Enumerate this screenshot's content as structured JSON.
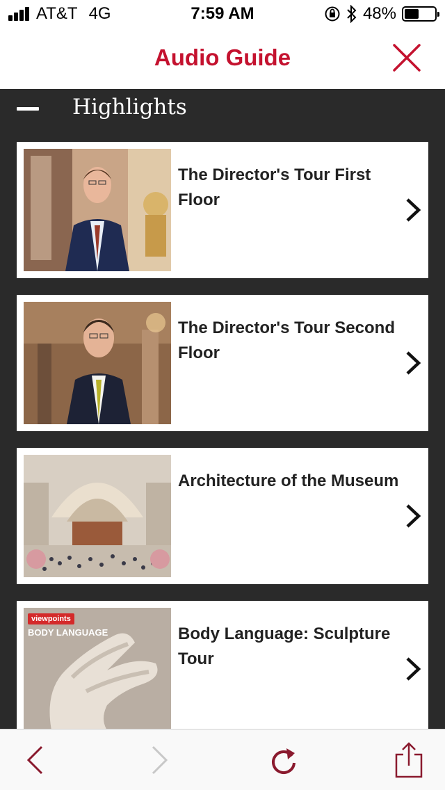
{
  "status_bar": {
    "carrier": "AT&T",
    "network": "4G",
    "time": "7:59 AM",
    "battery": "48%",
    "battery_level": 0.48
  },
  "header": {
    "title": "Audio Guide",
    "close_icon": "close-x-icon"
  },
  "section": {
    "title": "Highlights",
    "toggle_icon": "minus-icon"
  },
  "cards": [
    {
      "title": "The Director's Tour First Floor",
      "image": "director-portrait-first-floor"
    },
    {
      "title": "The Director's Tour Second Floor",
      "image": "director-portrait-second-floor"
    },
    {
      "title": "Architecture of the Museum",
      "image": "museum-great-hall"
    },
    {
      "title": "Body Language: Sculpture Tour",
      "image": "sculpture-hand",
      "badge": "viewpoints",
      "overlay": "BODY LANGUAGE"
    }
  ],
  "toolbar": {
    "back_icon": "chevron-left-icon",
    "forward_icon": "chevron-right-icon",
    "reload_icon": "reload-icon",
    "share_icon": "share-icon"
  },
  "colors": {
    "accent": "#c4122f",
    "dark_bg": "#2a2a2a",
    "toolbar_accent": "#8a1a2e",
    "disabled": "#c8c8c8"
  }
}
